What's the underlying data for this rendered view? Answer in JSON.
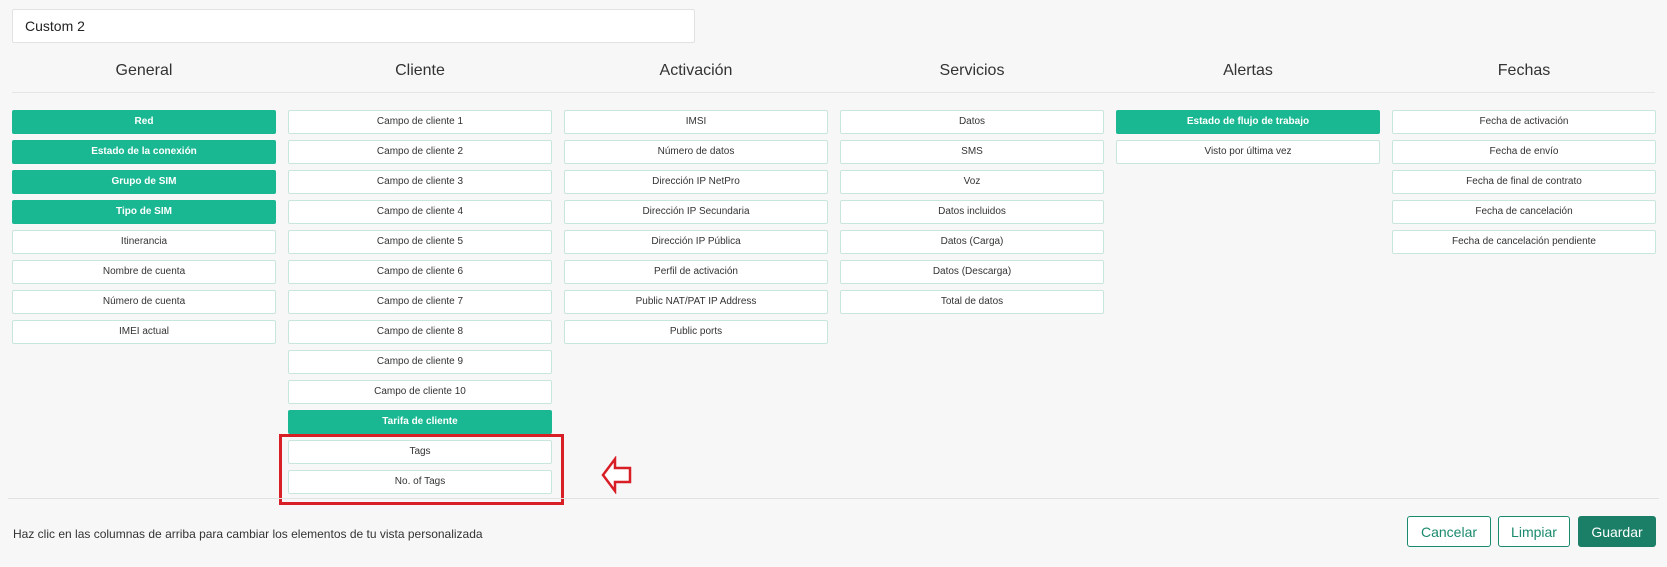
{
  "view": {
    "name_value": "Custom 2"
  },
  "columns": [
    {
      "title": "General",
      "items": [
        {
          "label": "Red",
          "selected": true
        },
        {
          "label": "Estado de la conexión",
          "selected": true
        },
        {
          "label": "Grupo de SIM",
          "selected": true
        },
        {
          "label": "Tipo de SIM",
          "selected": true
        },
        {
          "label": "Itinerancia",
          "selected": false
        },
        {
          "label": "Nombre de cuenta",
          "selected": false
        },
        {
          "label": "Número de cuenta",
          "selected": false
        },
        {
          "label": "IMEI actual",
          "selected": false
        }
      ]
    },
    {
      "title": "Cliente",
      "items": [
        {
          "label": "Campo de cliente 1",
          "selected": false
        },
        {
          "label": "Campo de cliente 2",
          "selected": false
        },
        {
          "label": "Campo de cliente 3",
          "selected": false
        },
        {
          "label": "Campo de cliente 4",
          "selected": false
        },
        {
          "label": "Campo de cliente 5",
          "selected": false
        },
        {
          "label": "Campo de cliente 6",
          "selected": false
        },
        {
          "label": "Campo de cliente 7",
          "selected": false
        },
        {
          "label": "Campo de cliente 8",
          "selected": false
        },
        {
          "label": "Campo de cliente 9",
          "selected": false
        },
        {
          "label": "Campo de cliente 10",
          "selected": false
        },
        {
          "label": "Tarifa de cliente",
          "selected": true
        },
        {
          "label": "Tags",
          "selected": false
        },
        {
          "label": "No. of Tags",
          "selected": false
        }
      ]
    },
    {
      "title": "Activación",
      "items": [
        {
          "label": "IMSI",
          "selected": false
        },
        {
          "label": "Número de datos",
          "selected": false
        },
        {
          "label": "Dirección IP NetPro",
          "selected": false
        },
        {
          "label": "Dirección IP Secundaria",
          "selected": false
        },
        {
          "label": "Dirección IP Pública",
          "selected": false
        },
        {
          "label": "Perfil de activación",
          "selected": false
        },
        {
          "label": "Public NAT/PAT IP Address",
          "selected": false
        },
        {
          "label": "Public ports",
          "selected": false
        }
      ]
    },
    {
      "title": "Servicios",
      "items": [
        {
          "label": "Datos",
          "selected": false
        },
        {
          "label": "SMS",
          "selected": false
        },
        {
          "label": "Voz",
          "selected": false
        },
        {
          "label": "Datos incluidos",
          "selected": false
        },
        {
          "label": "Datos (Carga)",
          "selected": false
        },
        {
          "label": "Datos (Descarga)",
          "selected": false
        },
        {
          "label": "Total de datos",
          "selected": false
        }
      ]
    },
    {
      "title": "Alertas",
      "items": [
        {
          "label": "Estado de flujo de trabajo",
          "selected": true
        },
        {
          "label": "Visto por última vez",
          "selected": false
        }
      ]
    },
    {
      "title": "Fechas",
      "items": [
        {
          "label": "Fecha de activación",
          "selected": false
        },
        {
          "label": "Fecha de envío",
          "selected": false
        },
        {
          "label": "Fecha de final de contrato",
          "selected": false
        },
        {
          "label": "Fecha de cancelación",
          "selected": false
        },
        {
          "label": "Fecha de cancelación pendiente",
          "selected": false
        }
      ]
    }
  ],
  "footer": {
    "help_text": "Haz clic en las columnas de arriba para cambiar los elementos de tu vista personalizada",
    "cancel_label": "Cancelar",
    "clear_label": "Limpiar",
    "save_label": "Guardar"
  },
  "colors": {
    "accent": "#19b893",
    "primary_button": "#1a7f66",
    "annotation_red": "#d81f26"
  },
  "icons": {
    "annotation": "left-arrow-icon"
  }
}
